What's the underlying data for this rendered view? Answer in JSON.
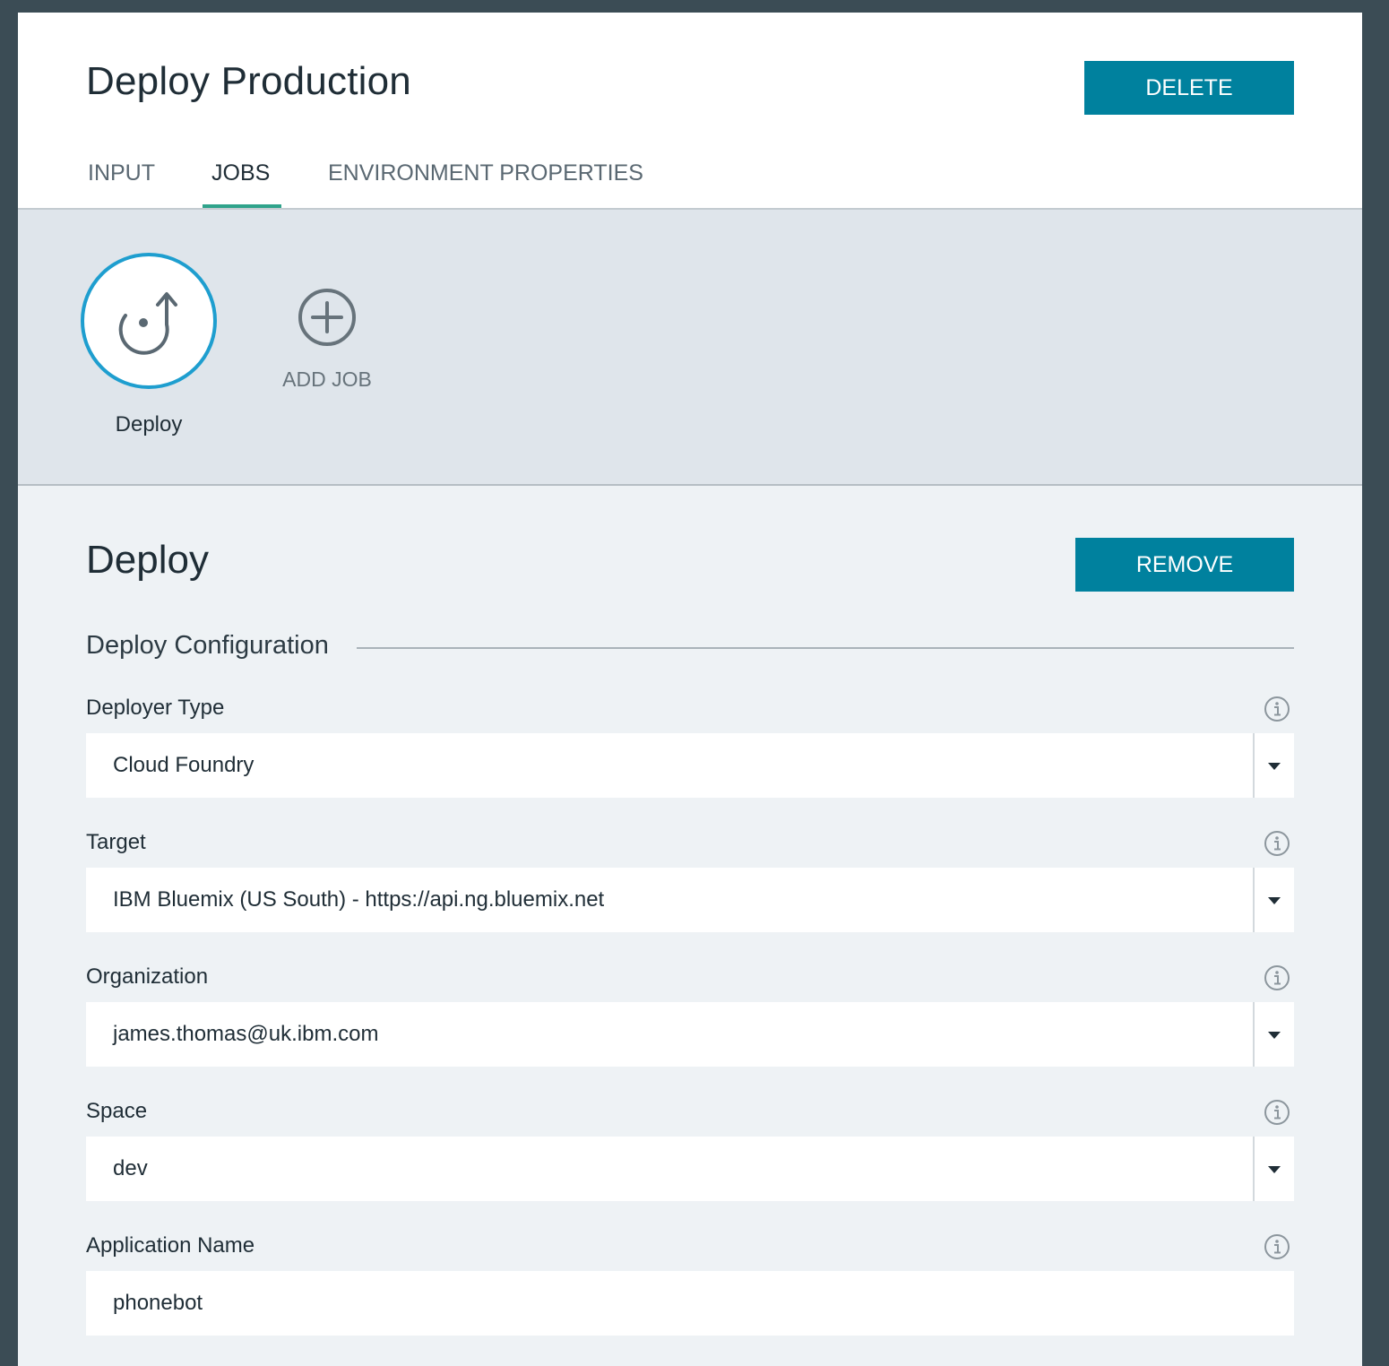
{
  "header": {
    "title": "Deploy Production",
    "delete_label": "DELETE"
  },
  "tabs": [
    {
      "label": "INPUT",
      "active": false
    },
    {
      "label": "JOBS",
      "active": true
    },
    {
      "label": "ENVIRONMENT PROPERTIES",
      "active": false
    }
  ],
  "jobs": {
    "items": [
      {
        "label": "Deploy",
        "icon": "deploy-icon",
        "selected": true
      }
    ],
    "add_label": "ADD JOB",
    "add_icon": "plus-circle-icon"
  },
  "job_detail": {
    "title": "Deploy",
    "remove_label": "REMOVE",
    "section_heading": "Deploy Configuration",
    "fields": {
      "deployer_type": {
        "label": "Deployer Type",
        "value": "Cloud Foundry"
      },
      "target": {
        "label": "Target",
        "value": "IBM Bluemix (US South) - https://api.ng.bluemix.net"
      },
      "organization": {
        "label": "Organization",
        "value": "james.thomas@uk.ibm.com"
      },
      "space": {
        "label": "Space",
        "value": "dev"
      },
      "application_name": {
        "label": "Application Name",
        "value": "phonebot"
      }
    }
  },
  "colors": {
    "accent": "#00819e",
    "active_tab_underline": "#2fa38b",
    "selected_job_ring": "#1e9ecf",
    "outer_background": "#3b4c55"
  }
}
